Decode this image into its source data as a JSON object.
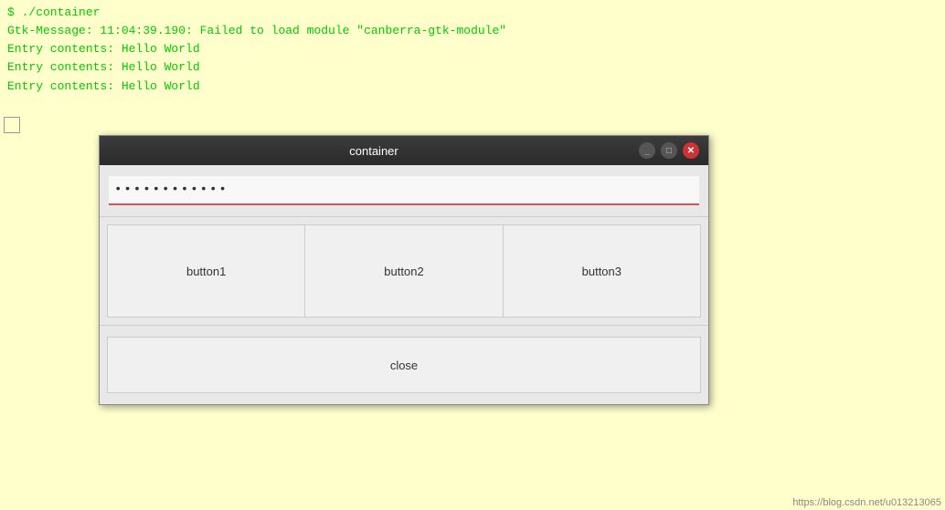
{
  "terminal": {
    "lines": [
      {
        "id": "cmd",
        "text": "$ ./container"
      },
      {
        "id": "error",
        "text": "Gtk-Message: 11:04:39.190: Failed to load module \"canberra-gtk-module\""
      },
      {
        "id": "out1",
        "text": "Entry contents: Hello World"
      },
      {
        "id": "out2",
        "text": "Entry contents: Hello World"
      },
      {
        "id": "out3",
        "text": "Entry contents: Hello World"
      }
    ]
  },
  "window": {
    "title": "container",
    "buttons": {
      "minimize": "_",
      "maximize": "□",
      "close": "✕"
    },
    "entry": {
      "value": "............",
      "placeholder": ""
    },
    "buttons_row": [
      {
        "id": "btn1",
        "label": "button1"
      },
      {
        "id": "btn2",
        "label": "button2"
      },
      {
        "id": "btn3",
        "label": "button3"
      }
    ],
    "close_button": {
      "label": "close"
    }
  },
  "watermark": {
    "text": "https://blog.csdn.net/u013213065"
  }
}
